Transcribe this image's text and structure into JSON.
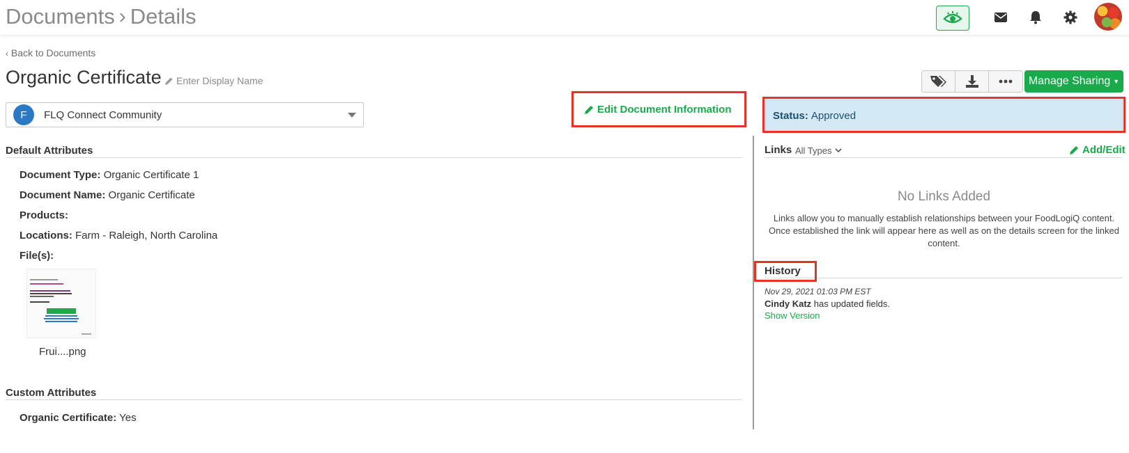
{
  "header": {
    "breadcrumb_root": "Documents",
    "breadcrumb_sep": "›",
    "breadcrumb_current": "Details",
    "icons": [
      "eye-icon",
      "envelope-icon",
      "bell-icon",
      "gear-icon",
      "avatar"
    ],
    "accent_color": "#1aaa4b"
  },
  "nav": {
    "back_label": "Back to Documents"
  },
  "document": {
    "title": "Organic Certificate",
    "display_name_placeholder": "Enter Display Name",
    "community_initial": "F",
    "community_name": "FLQ Connect Community",
    "edit_label": "Edit Document Information",
    "manage_sharing_label": "Manage Sharing",
    "status_label": "Status:",
    "status_value": "Approved"
  },
  "default_attributes": {
    "heading": "Default Attributes",
    "items": [
      {
        "label": "Document Type:",
        "value": "Organic Certificate 1"
      },
      {
        "label": "Document Name:",
        "value": "Organic Certificate"
      },
      {
        "label": "Products:",
        "value": ""
      },
      {
        "label": "Locations:",
        "value": "Farm - Raleigh, North Carolina"
      },
      {
        "label": "File(s):",
        "value": ""
      }
    ],
    "file_name": "Frui....png"
  },
  "custom_attributes": {
    "heading": "Custom Attributes",
    "items": [
      {
        "label": "Organic Certificate:",
        "value": "Yes"
      }
    ]
  },
  "links": {
    "heading": "Links",
    "filter_value": "All Types",
    "add_edit_label": "Add/Edit",
    "empty_title": "No Links Added",
    "empty_desc": "Links allow you to manually establish relationships between your FoodLogiQ content. Once established the link will appear here as well as on the details screen for the linked content."
  },
  "history": {
    "heading": "History",
    "entries": [
      {
        "date": "Nov 29, 2021 01:03 PM EST",
        "user": "Cindy Katz",
        "action": "has updated fields.",
        "link": "Show Version"
      }
    ]
  }
}
